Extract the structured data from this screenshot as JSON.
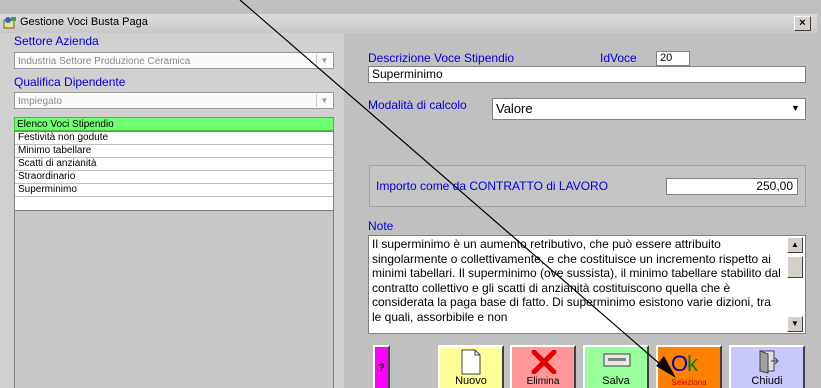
{
  "window": {
    "title": "Gestione Voci Busta Paga",
    "close_glyph": "×"
  },
  "left": {
    "settore_label": "Settore Azienda",
    "settore_value": "Industria Settore Produzione Ceramica",
    "qualifica_label": "Qualifica Dipendente",
    "qualifica_value": "Impiegato",
    "elenco_header": "Elenco Voci Stipendio",
    "items": [
      {
        "label": "Festività non godute"
      },
      {
        "label": "Minimo tabellare"
      },
      {
        "label": "Scatti di anzianità"
      },
      {
        "label": "Straordinario"
      },
      {
        "label": "Superminimo"
      }
    ]
  },
  "right": {
    "descrizione_label": "Descrizione Voce Stipendio",
    "idvoce_label": "IdVoce",
    "idvoce_value": "20",
    "descrizione_value": "Superminimo",
    "modalita_label": "Modalità di calcolo",
    "modalita_value": "Valore",
    "importo_label": "Importo come da CONTRATTO di LAVORO",
    "importo_value": "250,00",
    "note_label": "Note",
    "note_text": "Il superminimo è un aumento retributivo, che può essere attribuito singolarmente o collettivamente, e che costituisce un incremento rispetto ai minimi tabellari. Il superminimo (ove sussista), il minimo tabellare stabilito dal contratto collettivo e gli scatti di anzianità costituiscono quella che è considerata la paga base di fatto. Di superminimo esistono varie dizioni, tra le quali, assorbibile e non"
  },
  "buttons": {
    "help": "?",
    "nuovo": "Nuovo",
    "elimina": "Elimina",
    "salva": "Salva",
    "seleziona": "Seleziona",
    "chiudi": "Chiudi"
  },
  "colors": {
    "help_bg": "#ff00ff",
    "nuovo_bg": "#ffff99",
    "elimina_bg": "#ff9999",
    "salva_bg": "#99ff99",
    "seleziona_bg": "#ff8000",
    "chiudi_bg": "#c8c8ff",
    "annotation_arrow": "#000000"
  }
}
